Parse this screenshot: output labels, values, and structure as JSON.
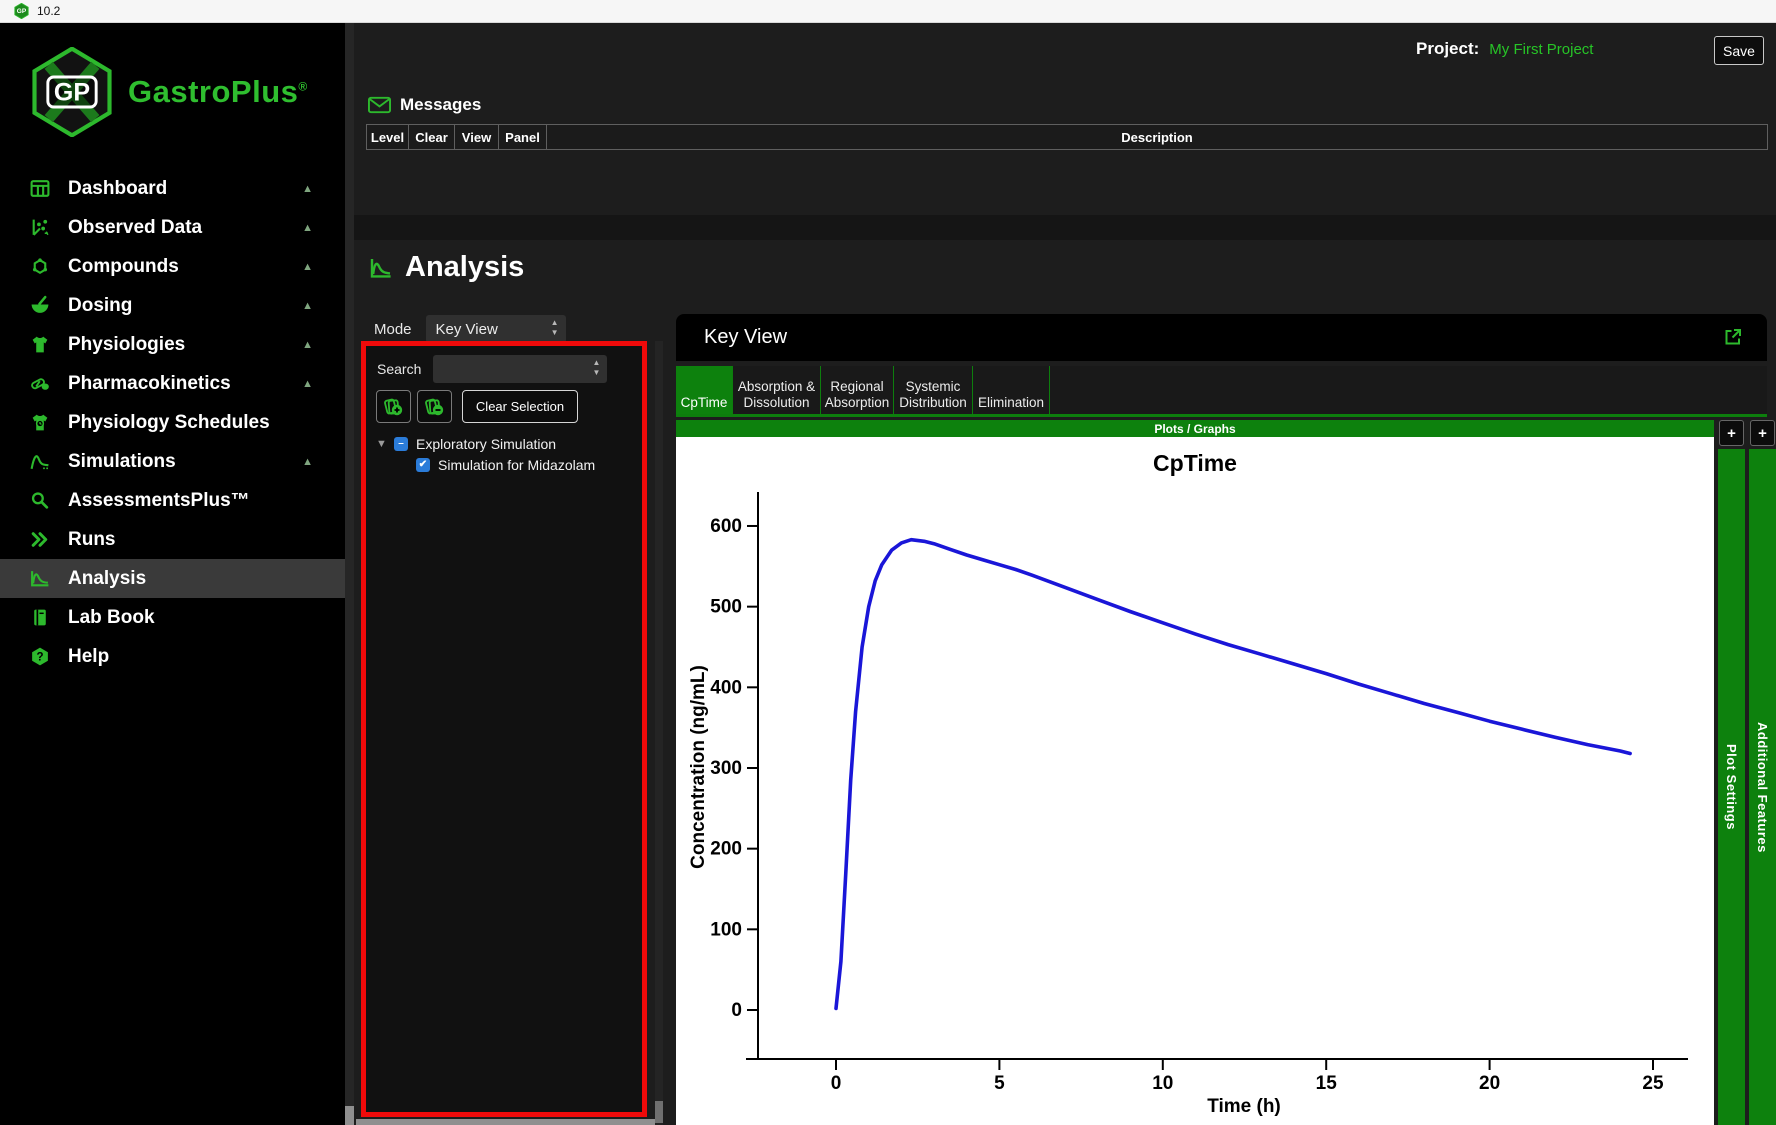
{
  "titlebar": {
    "version": "10.2"
  },
  "sidebar": {
    "logo_monogram": "GP",
    "logo_text": "GastroPlus",
    "logo_registered": "®",
    "items": [
      {
        "label": "Dashboard",
        "icon": "dashboard-icon",
        "collapsible": true,
        "active": false
      },
      {
        "label": "Observed Data",
        "icon": "observed-data-icon",
        "collapsible": true,
        "active": false
      },
      {
        "label": "Compounds",
        "icon": "compounds-icon",
        "collapsible": true,
        "active": false
      },
      {
        "label": "Dosing",
        "icon": "dosing-icon",
        "collapsible": true,
        "active": false
      },
      {
        "label": "Physiologies",
        "icon": "physiologies-icon",
        "collapsible": true,
        "active": false
      },
      {
        "label": "Pharmacokinetics",
        "icon": "pharmacokinetics-icon",
        "collapsible": true,
        "active": false
      },
      {
        "label": "Physiology Schedules",
        "icon": "physiology-schedules-icon",
        "collapsible": false,
        "active": false
      },
      {
        "label": "Simulations",
        "icon": "simulations-icon",
        "collapsible": true,
        "active": false
      },
      {
        "label": "AssessmentsPlus™",
        "icon": "assessmentsplus-icon",
        "collapsible": false,
        "active": false
      },
      {
        "label": "Runs",
        "icon": "runs-icon",
        "collapsible": false,
        "active": false
      },
      {
        "label": "Analysis",
        "icon": "analysis-icon",
        "collapsible": false,
        "active": true
      },
      {
        "label": "Lab Book",
        "icon": "lab-book-icon",
        "collapsible": false,
        "active": false
      },
      {
        "label": "Help",
        "icon": "help-icon",
        "collapsible": false,
        "active": false
      }
    ]
  },
  "header": {
    "project_label": "Project:",
    "project_name": "My First Project",
    "save_label": "Save"
  },
  "messages": {
    "title": "Messages",
    "columns": [
      "Level",
      "Clear",
      "View",
      "Panel",
      "Description"
    ]
  },
  "analysis": {
    "title": "Analysis",
    "mode_label": "Mode",
    "mode_value": "Key View",
    "search_label": "Search",
    "search_value": "",
    "clear_selection_label": "Clear Selection",
    "tree": {
      "root": "Exploratory Simulation",
      "root_state": "indeterminate",
      "child": "Simulation for Midazolam",
      "child_state": "checked"
    }
  },
  "keyview": {
    "title": "Key View",
    "tabs": [
      {
        "label": "CpTime",
        "active": true
      },
      {
        "label": "Absorption & Dissolution",
        "active": false
      },
      {
        "label": "Regional Absorption",
        "active": false
      },
      {
        "label": "Systemic Distribution",
        "active": false
      },
      {
        "label": "Elimination",
        "active": false
      }
    ],
    "plots_bar": "Plots / Graphs",
    "side_panels": [
      {
        "label": "Plot Settings"
      },
      {
        "label": "Additional Features"
      }
    ]
  },
  "colors": {
    "brand_green": "#2fbe2f",
    "icon_green": "#2db92d",
    "dark_green": "#0d810d",
    "checkbox_blue": "#2b7cd9",
    "selection_red": "#f00a0a",
    "curve_blue": "#1a16d8"
  },
  "chart_data": {
    "type": "line",
    "title": "CpTime",
    "xlabel": "Time (h)",
    "ylabel": "Concentration (ng/mL)",
    "xticks": [
      0,
      5,
      10,
      15,
      20,
      25
    ],
    "yticks": [
      0,
      100,
      200,
      300,
      400,
      500,
      600
    ],
    "xlim": [
      -2.5,
      26
    ],
    "ylim": [
      -40,
      660
    ],
    "grid": false,
    "legend": "none",
    "line_color": "#1a16d8",
    "series": [
      {
        "name": "Simulation for Midazolam",
        "x": [
          0,
          0.15,
          0.3,
          0.45,
          0.6,
          0.8,
          1,
          1.2,
          1.4,
          1.7,
          2,
          2.3,
          2.7,
          3,
          3.5,
          4,
          4.5,
          5,
          5.5,
          6,
          7,
          8,
          9,
          10,
          11,
          12,
          13,
          14,
          15,
          16,
          17,
          18,
          19,
          20,
          21,
          22,
          23,
          24,
          24.3
        ],
        "y": [
          2,
          60,
          170,
          285,
          370,
          450,
          500,
          532,
          552,
          570,
          579,
          583,
          581,
          578,
          571,
          564,
          558,
          552,
          546,
          539,
          524,
          509,
          494,
          480,
          466,
          453,
          441,
          429,
          417,
          404,
          392,
          380,
          369,
          358,
          348,
          338,
          329,
          321,
          318
        ]
      }
    ]
  }
}
